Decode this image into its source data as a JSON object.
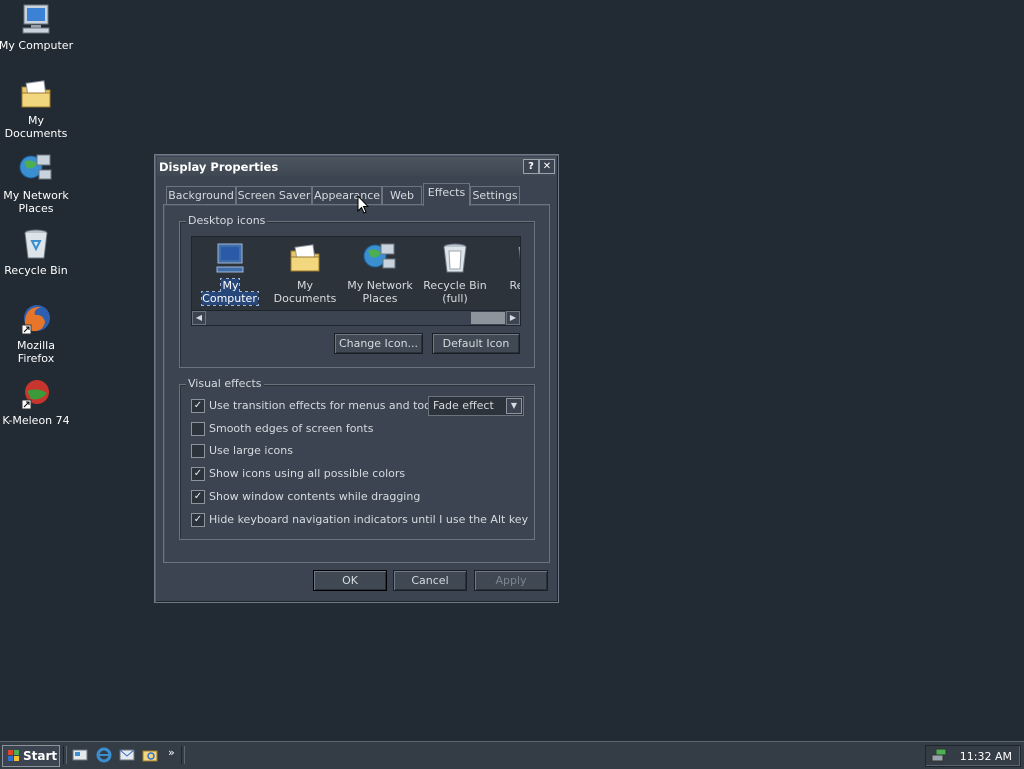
{
  "desktop": {
    "icons": [
      {
        "label": "My Computer",
        "icon": "my-computer-icon"
      },
      {
        "label": "My Documents",
        "icon": "my-documents-icon"
      },
      {
        "label": "My Network\nPlaces",
        "icon": "network-places-icon"
      },
      {
        "label": "Recycle Bin",
        "icon": "recycle-bin-icon"
      },
      {
        "label": "Mozilla Firefox",
        "icon": "firefox-icon"
      },
      {
        "label": "K-Meleon 74",
        "icon": "k-meleon-icon"
      }
    ]
  },
  "window": {
    "title": "Display Properties",
    "help_label": "?",
    "close_label": "✕",
    "tabs": [
      "Background",
      "Screen Saver",
      "Appearance",
      "Web",
      "Effects",
      "Settings"
    ],
    "active_tab": "Effects",
    "desktop_icons": {
      "group_label": "Desktop icons",
      "items": [
        {
          "label": "My Computer",
          "selected": true
        },
        {
          "label": "My Documents"
        },
        {
          "label": "My Network Places"
        },
        {
          "label": "Recycle Bin (full)"
        },
        {
          "label": "Recy (e"
        }
      ],
      "change_icon_label": "Change Icon...",
      "default_icon_label": "Default Icon"
    },
    "visual_effects": {
      "group_label": "Visual effects",
      "options": [
        {
          "label": "Use transition effects for menus and tooltips",
          "checked": true
        },
        {
          "label": "Smooth edges of screen fonts",
          "checked": false
        },
        {
          "label": "Use large icons",
          "checked": false
        },
        {
          "label": "Show icons using all possible colors",
          "checked": true
        },
        {
          "label": "Show window contents while dragging",
          "checked": true
        },
        {
          "label": "Hide keyboard navigation indicators until I use the Alt key",
          "checked": true
        }
      ],
      "transition_effect": "Fade effect"
    },
    "buttons": {
      "ok": "OK",
      "cancel": "Cancel",
      "apply": "Apply"
    }
  },
  "taskbar": {
    "start_label": "Start",
    "chevron": "»",
    "clock": "11:32 AM"
  },
  "colors": {
    "desktop": "#222a33",
    "window": "#3b4450",
    "selection": "#27477a"
  }
}
